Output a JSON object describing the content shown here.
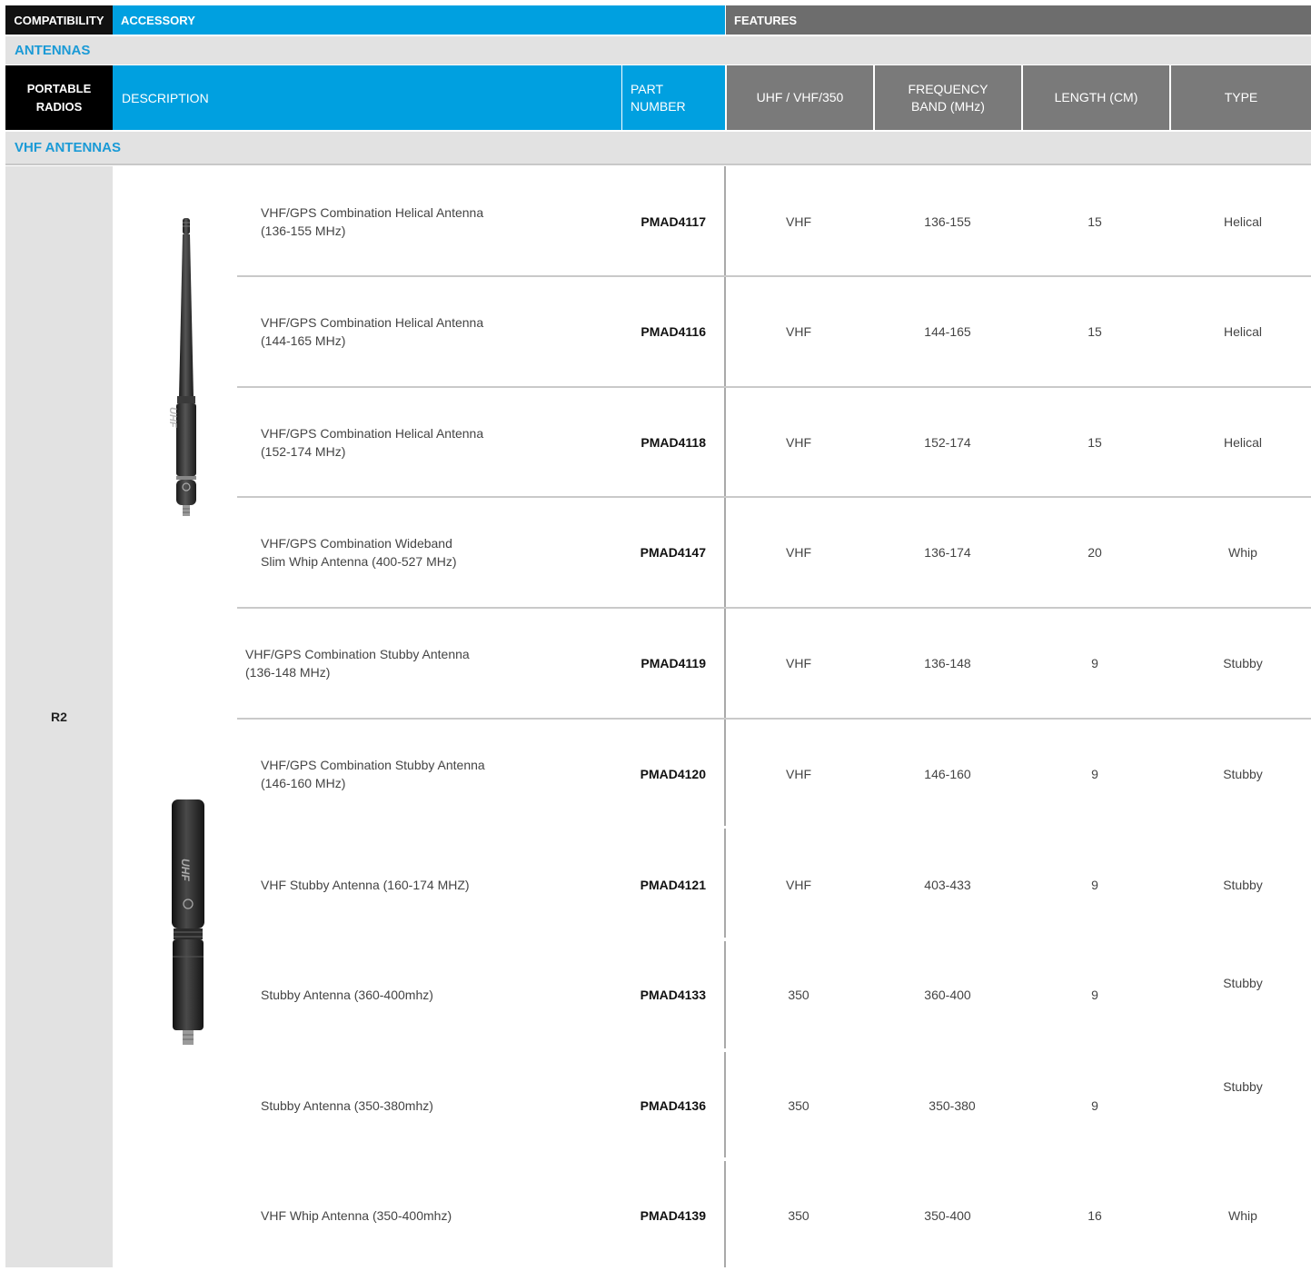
{
  "header": {
    "compatibility": "COMPATIBILITY",
    "accessory": "ACCESSORY",
    "features": "FEATURES"
  },
  "section": "ANTENNAS",
  "columns": {
    "portable_radios": "PORTABLE RADIOS",
    "description": "DESCRIPTION",
    "part_number": "PART NUMBER",
    "band": "UHF / VHF/350",
    "frequency": "FREQUENCY BAND (MHz)",
    "length": "LENGTH (CM)",
    "type": "TYPE"
  },
  "subsection": "VHF ANTENNAS",
  "radio_model": "R2",
  "rows": [
    {
      "desc1": "VHF/GPS Combination Helical Antenna",
      "desc2": "(136-155 MHz)",
      "part": "PMAD4117",
      "band": "VHF",
      "freq": "136-155",
      "length": "15",
      "type": "Helical"
    },
    {
      "desc1": "VHF/GPS Combination Helical Antenna",
      "desc2": "(144-165 MHz)",
      "part": "PMAD4116",
      "band": "VHF",
      "freq": "144-165",
      "length": "15",
      "type": "Helical"
    },
    {
      "desc1": "VHF/GPS Combination Helical Antenna",
      "desc2": "(152-174 MHz)",
      "part": "PMAD4118",
      "band": "VHF",
      "freq": "152-174",
      "length": "15",
      "type": "Helical"
    },
    {
      "desc1": "VHF/GPS Combination Wideband",
      "desc2": "Slim Whip Antenna (400-527 MHz)",
      "part": "PMAD4147",
      "band": "VHF",
      "freq": "136-174",
      "length": "20",
      "type": "Whip"
    },
    {
      "desc1": "VHF/GPS Combination Stubby Antenna",
      "desc2": "(136-148 MHz)",
      "part": "PMAD4119",
      "band": "VHF",
      "freq": "136-148",
      "length": "9",
      "type": "Stubby"
    },
    {
      "desc1": "VHF/GPS Combination Stubby Antenna",
      "desc2": "(146-160 MHz)",
      "part": "PMAD4120",
      "band": "VHF",
      "freq": "146-160",
      "length": "9",
      "type": "Stubby"
    },
    {
      "desc1": "VHF Stubby Antenna (160-174 MHZ)",
      "desc2": "",
      "part": "PMAD4121",
      "band": "VHF",
      "freq": "403-433",
      "length": "9",
      "type": "Stubby"
    },
    {
      "desc1": "Stubby Antenna (360-400mhz)",
      "desc2": "",
      "part": "PMAD4133",
      "band": "350",
      "freq": "360-400",
      "length": "9",
      "type": "Stubby"
    },
    {
      "desc1": "Stubby Antenna (350-380mhz)",
      "desc2": "",
      "part": "PMAD4136",
      "band": "350",
      "freq": "350-380",
      "length": "9",
      "type": "Stubby"
    },
    {
      "desc1": "VHF Whip Antenna (350-400mhz)",
      "desc2": "",
      "part": "PMAD4139",
      "band": "350",
      "freq": "350-400",
      "length": "16",
      "type": "Whip"
    }
  ],
  "images": {
    "helical_label": "UHF",
    "stubby_label": "UHF"
  }
}
